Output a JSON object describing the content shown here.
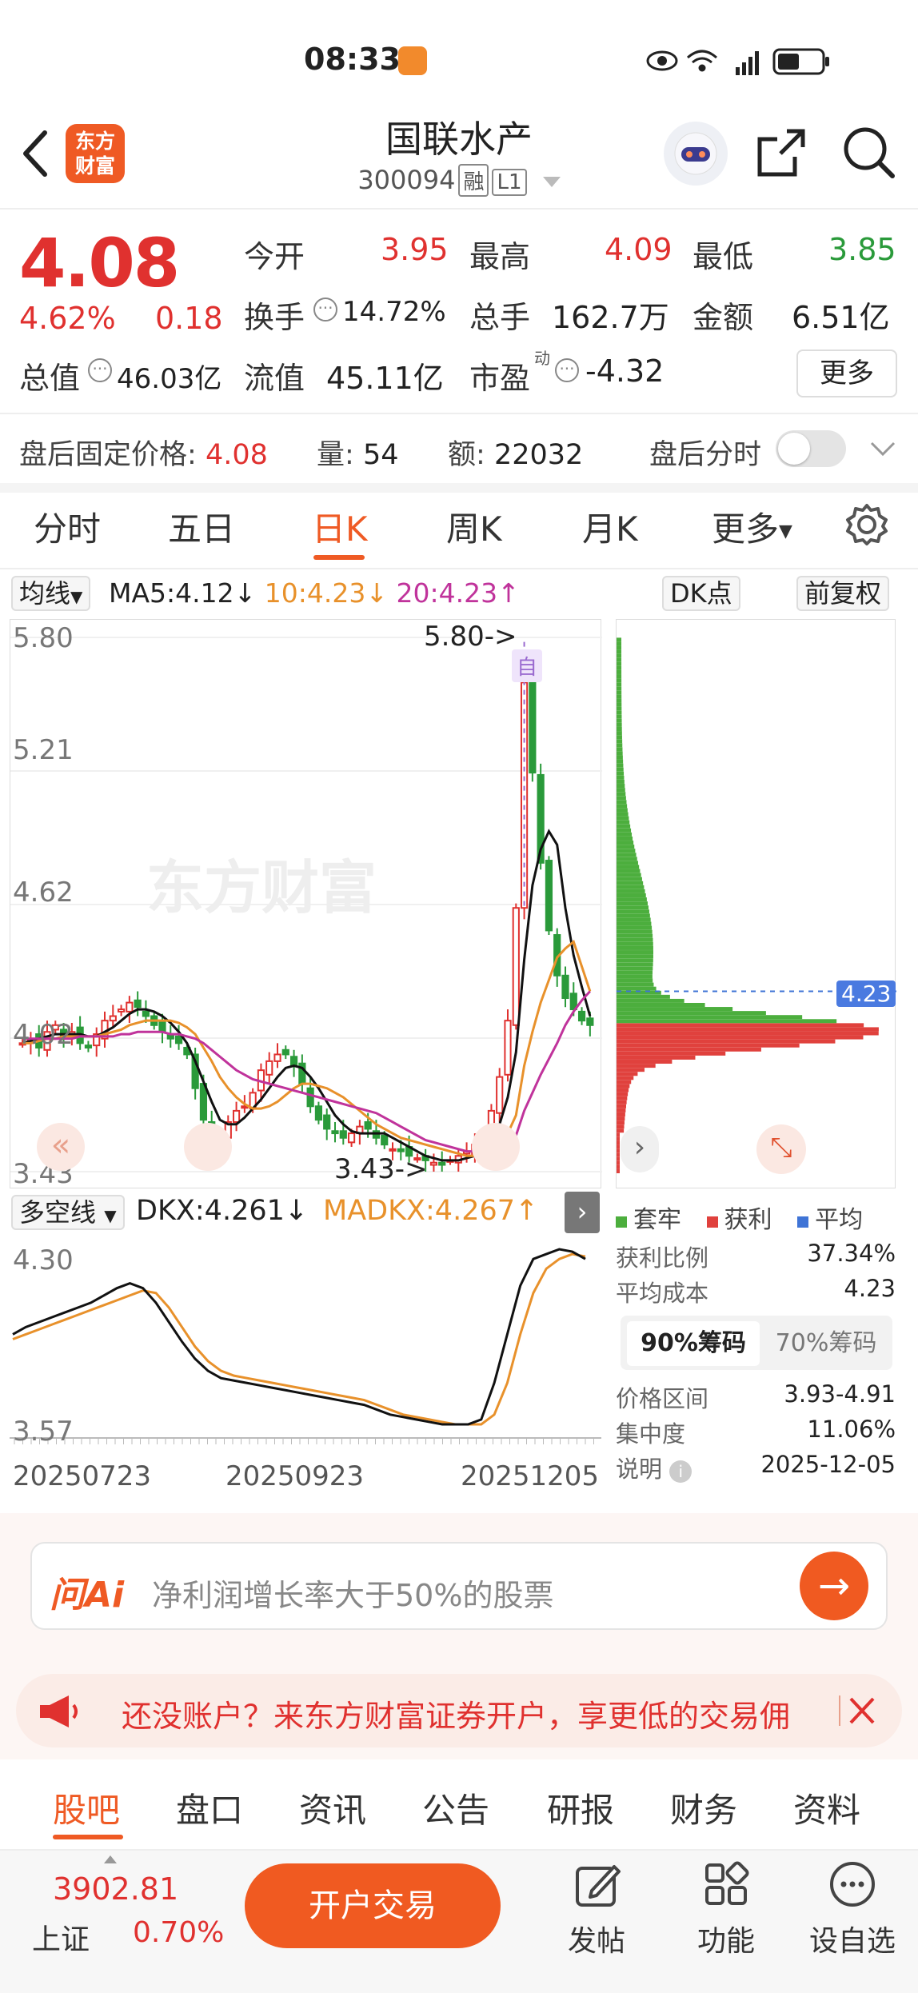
{
  "status": {
    "time": "08:33"
  },
  "header": {
    "stock_name": "国联水产",
    "stock_code": "300094",
    "tag_margin": "融",
    "tag_level": "L1",
    "logo_text_1": "东方",
    "logo_text_2": "财富"
  },
  "quote": {
    "price": "4.08",
    "change_pct": "4.62%",
    "change": "0.18",
    "open_label": "今开",
    "open": "3.95",
    "high_label": "最高",
    "high": "4.09",
    "low_label": "最低",
    "low": "3.85",
    "turnover_label": "换手",
    "turnover": "14.72%",
    "volume_label": "总手",
    "volume": "162.7万",
    "amount_label": "金额",
    "amount": "6.51亿",
    "mktcap_label": "总值",
    "mktcap": "46.03亿",
    "float_label": "流值",
    "float_cap": "45.11亿",
    "pe_label": "市盈",
    "pe_sup": "动",
    "pe": "-4.32",
    "more": "更多"
  },
  "after_hours": {
    "price_label": "盘后固定价格:",
    "price": "4.08",
    "vol_label": "量:",
    "vol": "54",
    "amt_label": "额:",
    "amt": "22032",
    "intraday_label": "盘后分时"
  },
  "ktabs": [
    "分时",
    "五日",
    "日K",
    "周K",
    "月K",
    "更多"
  ],
  "ma": {
    "selector": "均线",
    "ma5": "MA5:4.12↓",
    "ma10": "10:4.23↓",
    "ma20": "20:4.23↑",
    "dk_button": "DK点",
    "adjust_button": "前复权"
  },
  "chart_data": {
    "type": "candlestick",
    "y_ticks": [
      "5.80",
      "5.21",
      "4.62",
      "4.02",
      "3.43"
    ],
    "ylim": [
      3.43,
      5.8
    ],
    "max_marker": "5.80->",
    "min_marker": "3.43->",
    "self_marker": "自",
    "watermark": "东方财富",
    "closes": [
      4.0,
      4.02,
      3.98,
      4.05,
      4.08,
      4.03,
      4.05,
      4.0,
      3.98,
      4.04,
      4.1,
      4.12,
      4.15,
      4.18,
      4.16,
      4.12,
      4.08,
      4.05,
      4.02,
      4.0,
      3.95,
      3.8,
      3.66,
      3.6,
      3.6,
      3.65,
      3.7,
      3.72,
      3.78,
      3.88,
      3.92,
      3.95,
      3.95,
      3.9,
      3.82,
      3.72,
      3.66,
      3.62,
      3.6,
      3.58,
      3.6,
      3.63,
      3.62,
      3.58,
      3.55,
      3.53,
      3.52,
      3.5,
      3.49,
      3.48,
      3.47,
      3.46,
      3.48,
      3.5,
      3.52,
      3.55,
      3.6,
      3.7,
      3.85,
      4.1,
      4.6,
      5.6,
      5.2,
      4.8,
      4.5,
      4.3,
      4.2,
      4.15,
      4.1,
      4.08
    ],
    "ma_series": [
      {
        "name": "MA5",
        "color": "#111111",
        "values": [
          4.0,
          4.01,
          4.02,
          4.03,
          4.04,
          4.04,
          4.04,
          4.04,
          4.03,
          4.03,
          4.05,
          4.07,
          4.1,
          4.13,
          4.15,
          4.15,
          4.14,
          4.12,
          4.09,
          4.05,
          4.0,
          3.92,
          3.83,
          3.74,
          3.66,
          3.64,
          3.64,
          3.67,
          3.71,
          3.75,
          3.8,
          3.85,
          3.89,
          3.9,
          3.89,
          3.85,
          3.8,
          3.74,
          3.68,
          3.64,
          3.61,
          3.6,
          3.6,
          3.6,
          3.6,
          3.58,
          3.56,
          3.54,
          3.52,
          3.5,
          3.49,
          3.48,
          3.48,
          3.48,
          3.49,
          3.5,
          3.53,
          3.57,
          3.64,
          3.76,
          3.96,
          4.37,
          4.7,
          4.86,
          4.94,
          4.88,
          4.6,
          4.39,
          4.25,
          4.12
        ]
      },
      {
        "name": "MA10",
        "color": "#e8912b",
        "values": [
          4.0,
          4.0,
          4.01,
          4.02,
          4.02,
          4.03,
          4.03,
          4.03,
          4.03,
          4.03,
          4.04,
          4.05,
          4.06,
          4.08,
          4.09,
          4.1,
          4.1,
          4.1,
          4.1,
          4.09,
          4.07,
          4.04,
          3.98,
          3.92,
          3.85,
          3.8,
          3.76,
          3.73,
          3.71,
          3.71,
          3.72,
          3.74,
          3.77,
          3.8,
          3.82,
          3.82,
          3.81,
          3.8,
          3.78,
          3.76,
          3.73,
          3.7,
          3.67,
          3.64,
          3.62,
          3.6,
          3.58,
          3.57,
          3.56,
          3.55,
          3.54,
          3.53,
          3.52,
          3.51,
          3.5,
          3.5,
          3.51,
          3.52,
          3.55,
          3.6,
          3.68,
          3.9,
          4.05,
          4.18,
          4.28,
          4.38,
          4.42,
          4.45,
          4.34,
          4.23
        ]
      },
      {
        "name": "MA20",
        "color": "#c0339b",
        "values": [
          4.02,
          4.02,
          4.02,
          4.02,
          4.02,
          4.02,
          4.02,
          4.03,
          4.03,
          4.03,
          4.03,
          4.03,
          4.04,
          4.04,
          4.05,
          4.05,
          4.05,
          4.05,
          4.04,
          4.04,
          4.03,
          4.02,
          4.0,
          3.97,
          3.94,
          3.91,
          3.88,
          3.86,
          3.84,
          3.83,
          3.82,
          3.81,
          3.8,
          3.79,
          3.78,
          3.77,
          3.76,
          3.75,
          3.74,
          3.73,
          3.72,
          3.71,
          3.7,
          3.69,
          3.67,
          3.65,
          3.63,
          3.61,
          3.59,
          3.57,
          3.56,
          3.55,
          3.54,
          3.53,
          3.52,
          3.52,
          3.52,
          3.52,
          3.53,
          3.55,
          3.59,
          3.7,
          3.78,
          3.86,
          3.93,
          4.0,
          4.08,
          4.14,
          4.19,
          4.23
        ]
      }
    ]
  },
  "chip_panel": {
    "avg_label": "4.23",
    "legend": [
      {
        "name": "套牢",
        "color": "#4cae3d"
      },
      {
        "name": "获利",
        "color": "#e0413d"
      },
      {
        "name": "平均",
        "color": "#3f74d6"
      }
    ],
    "profit_ratio_label": "获利比例",
    "profit_ratio": "37.34%",
    "avg_cost_label": "平均成本",
    "avg_cost": "4.23",
    "tab_90": "90%筹码",
    "tab_70": "70%筹码",
    "range_label": "价格区间",
    "range": "3.93-4.91",
    "concentration_label": "集中度",
    "concentration": "11.06%",
    "note_label": "说明",
    "note_date": "2025-12-05"
  },
  "dk": {
    "selector": "多空线",
    "dkx": "DKX:4.261↓",
    "madkx": "MADKX:4.267↑",
    "y_top": "4.30",
    "y_bottom": "3.57",
    "dates": [
      "20250723",
      "20250923",
      "20251205"
    ]
  },
  "ai": {
    "logo": "问Ai",
    "placeholder": "净利润增长率大于50%的股票"
  },
  "banner": {
    "text": "还没账户？来东方财富证券开户，享更低的交易佣"
  },
  "btabs": [
    "股吧",
    "盘口",
    "资讯",
    "公告",
    "研报",
    "财务",
    "资料"
  ],
  "footer": {
    "index_value": "3902.81",
    "index_name": "上证",
    "index_change": "0.70%",
    "trade_button": "开户交易",
    "post": "发帖",
    "functions": "功能",
    "watchlist": "设自选"
  }
}
